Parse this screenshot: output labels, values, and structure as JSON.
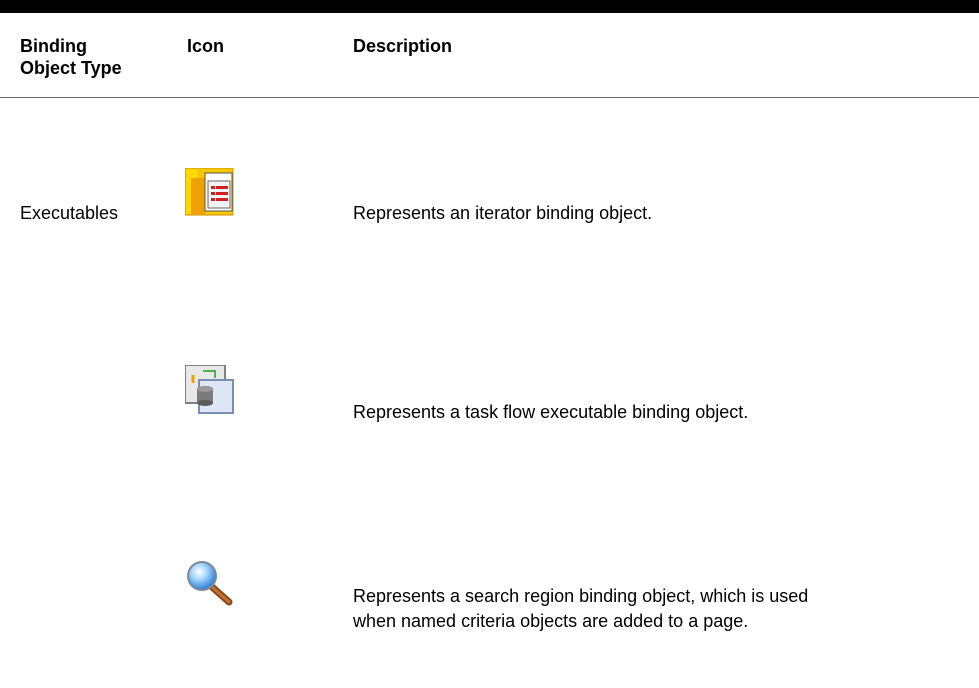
{
  "table": {
    "headers": {
      "type": "Binding\nObject Type",
      "type_line1": "Binding",
      "type_line2": "Object Type",
      "icon": "Icon",
      "description": "Description"
    },
    "rows": [
      {
        "type": "Executables",
        "icon": "iterator-binding-icon",
        "description": "Represents an iterator binding object."
      },
      {
        "type": "",
        "icon": "task-flow-binding-icon",
        "description": "Represents a task flow executable binding object."
      },
      {
        "type": "",
        "icon": "search-region-binding-icon",
        "description_line1": "Represents a search region binding object, which is used",
        "description_line2": "when named criteria objects are added to a page."
      }
    ]
  }
}
